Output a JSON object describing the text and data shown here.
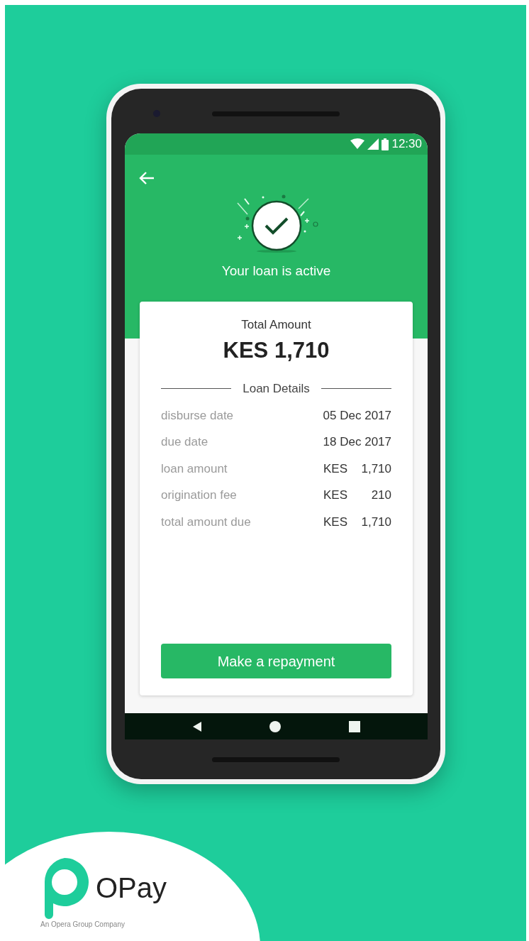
{
  "status_bar": {
    "time": "12:30"
  },
  "header": {
    "title": "Your loan is active"
  },
  "summary": {
    "label": "Total Amount",
    "amount": "KES 1,710"
  },
  "section_title": "Loan Details",
  "details": [
    {
      "kind": "date",
      "label": "disburse date",
      "value": "05 Dec 2017"
    },
    {
      "kind": "date",
      "label": "due date",
      "value": "18 Dec 2017"
    },
    {
      "kind": "money",
      "label": "loan amount",
      "currency": "KES",
      "value": "1,710"
    },
    {
      "kind": "money",
      "label": "origination fee",
      "currency": "KES",
      "value": "210"
    },
    {
      "kind": "money",
      "label": "total amount due",
      "currency": "KES",
      "value": "1,710"
    }
  ],
  "button": "Make a repayment",
  "brand": {
    "name": "OPay",
    "tagline": "An Opera Group Company"
  }
}
